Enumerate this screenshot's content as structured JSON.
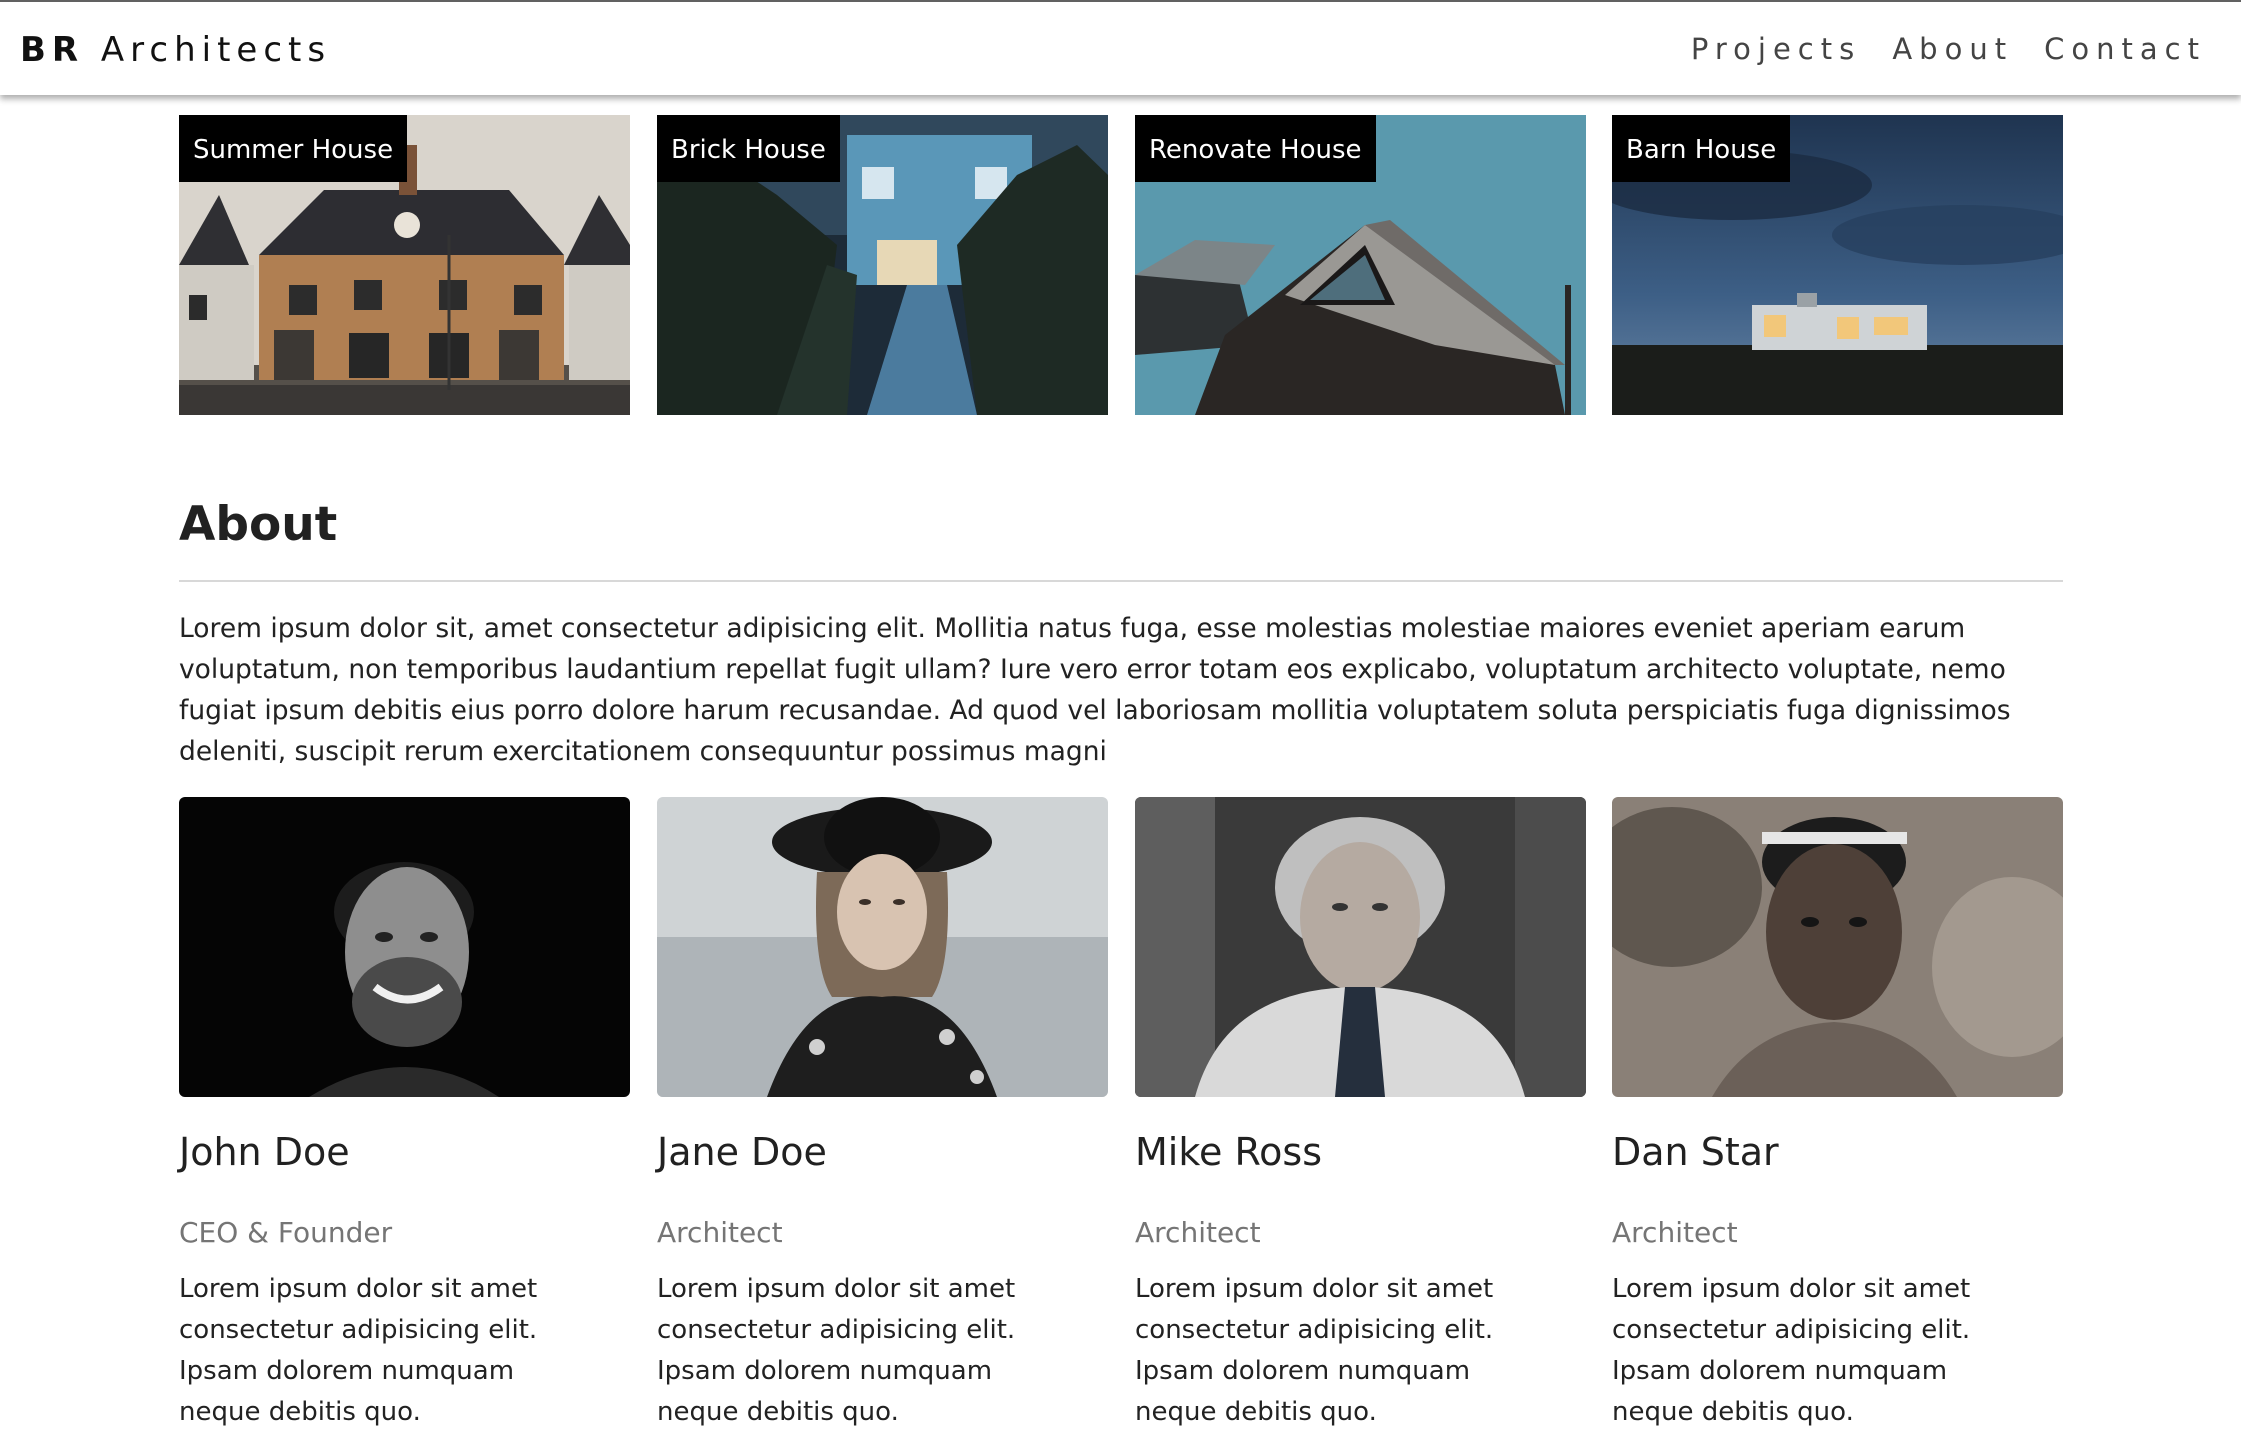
{
  "brand": {
    "bold": "BR",
    "rest": "Architects"
  },
  "nav": [
    "Projects",
    "About",
    "Contact"
  ],
  "projects": [
    {
      "name": "Summer House"
    },
    {
      "name": "Brick House"
    },
    {
      "name": "Renovate House"
    },
    {
      "name": "Barn House"
    }
  ],
  "about": {
    "title": "About",
    "text": "Lorem ipsum dolor sit, amet consectetur adipisicing elit. Mollitia natus fuga, esse molestias molestiae maiores eveniet aperiam earum voluptatum, non temporibus laudantium repellat fugit ullam? Iure vero error totam eos explicabo, voluptatum architecto voluptate, nemo fugiat ipsum debitis eius porro dolore harum recusandae. Ad quod vel laboriosam mollitia voluptatem soluta perspiciatis fuga dignissimos deleniti, suscipit rerum exercitationem consequuntur possimus magni"
  },
  "team": [
    {
      "name": "John Doe",
      "title": "CEO & Founder",
      "bio": "Lorem ipsum dolor sit amet consectetur adipisicing elit. Ipsam dolorem numquam neque debitis quo."
    },
    {
      "name": "Jane Doe",
      "title": "Architect",
      "bio": "Lorem ipsum dolor sit amet consectetur adipisicing elit. Ipsam dolorem numquam neque debitis quo."
    },
    {
      "name": "Mike Ross",
      "title": "Architect",
      "bio": "Lorem ipsum dolor sit amet consectetur adipisicing elit. Ipsam dolorem numquam neque debitis quo."
    },
    {
      "name": "Dan Star",
      "title": "Architect",
      "bio": "Lorem ipsum dolor sit amet consectetur adipisicing elit. Ipsam dolorem numquam neque debitis quo."
    }
  ],
  "colors": {
    "label_bg": "#000000",
    "text": "#212121",
    "muted": "#757575",
    "divider": "#d8d8d8"
  }
}
